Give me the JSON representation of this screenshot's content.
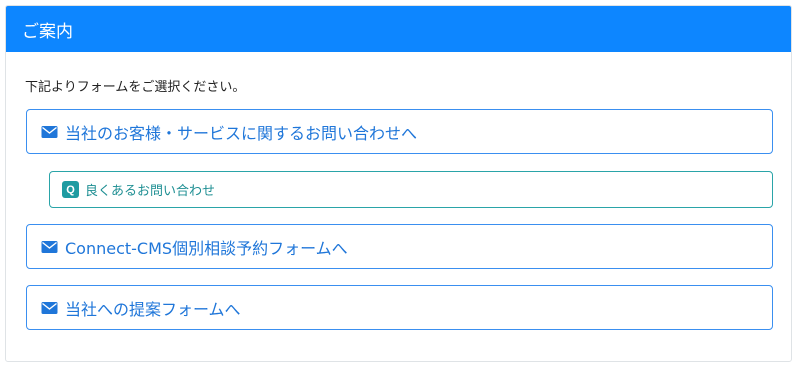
{
  "card": {
    "header_title": "ご案内",
    "intro_text": "下記よりフォームをご選択ください。"
  },
  "links": [
    {
      "label": "当社のお客様・サービスに関するお問い合わせへ",
      "icon": "envelope-icon"
    },
    {
      "label": "良くあるお問い合わせ",
      "icon": "q-badge-icon",
      "badge": "Q"
    },
    {
      "label": "Connect-CMS個別相談予約フォームへ",
      "icon": "envelope-icon"
    },
    {
      "label": "当社への提案フォームへ",
      "icon": "envelope-icon"
    }
  ],
  "colors": {
    "header_bg": "#0d86ff",
    "primary_link": "#1f76d9",
    "primary_border": "#3a8ff0",
    "faq_link": "#1f8f93",
    "faq_border": "#2aa4a8",
    "faq_badge": "#1e9ba1"
  }
}
